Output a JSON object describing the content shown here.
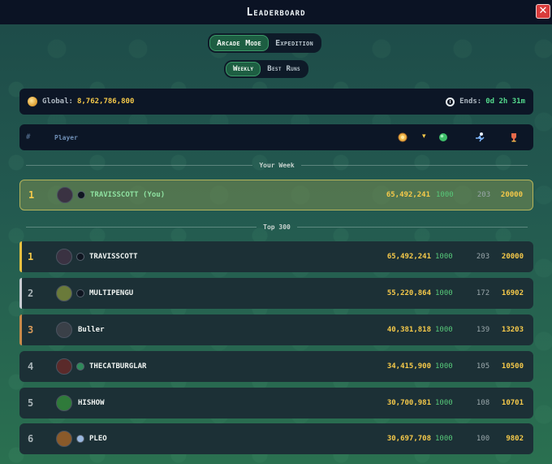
{
  "title": "Leaderboard",
  "close_label": "✕",
  "mode_tabs": [
    "Arcade Mode",
    "Expedition"
  ],
  "period_tabs": [
    "Weekly",
    "Best Runs"
  ],
  "stats": {
    "global_label": "Global:",
    "global_value": "8,762,786,800",
    "ends_label": "Ends:",
    "ends_value": "0d 2h 31m"
  },
  "table_header": {
    "rank_label": "#",
    "player_label": "Player",
    "sort_arrow": "▾"
  },
  "sections": {
    "your_week": "Your Week",
    "top": "Top 300"
  },
  "your_row": {
    "rank": "1",
    "name": "TRAVISSCOTT (You)",
    "score": "65,492,241",
    "level": "1000",
    "runs": "203",
    "points": "20000"
  },
  "rows": [
    {
      "rank": "1",
      "name": "TRAVISSCOTT",
      "score": "65,492,241",
      "level": "1000",
      "runs": "203",
      "points": "20000",
      "edge": "#e8c040"
    },
    {
      "rank": "2",
      "name": "MULTIPENGU",
      "score": "55,220,864",
      "level": "1000",
      "runs": "172",
      "points": "16902",
      "edge": "#c8ccd2"
    },
    {
      "rank": "3",
      "name": "Buller",
      "score": "40,381,818",
      "level": "1000",
      "runs": "139",
      "points": "13203",
      "edge": "#c88a4a"
    },
    {
      "rank": "4",
      "name": "THECATBURGLAR",
      "score": "34,415,900",
      "level": "1000",
      "runs": "105",
      "points": "10500",
      "edge": ""
    },
    {
      "rank": "5",
      "name": "HISHOW",
      "score": "30,700,981",
      "level": "1000",
      "runs": "108",
      "points": "10701",
      "edge": ""
    },
    {
      "rank": "6",
      "name": "PLEO",
      "score": "30,697,708",
      "level": "1000",
      "runs": "100",
      "points": "9802",
      "edge": ""
    }
  ],
  "colors": {
    "gold": "#f5c94a",
    "green": "#57c97a",
    "accent_green": "#53d98c",
    "panel": "#0c1626",
    "row": "#1c3036"
  }
}
